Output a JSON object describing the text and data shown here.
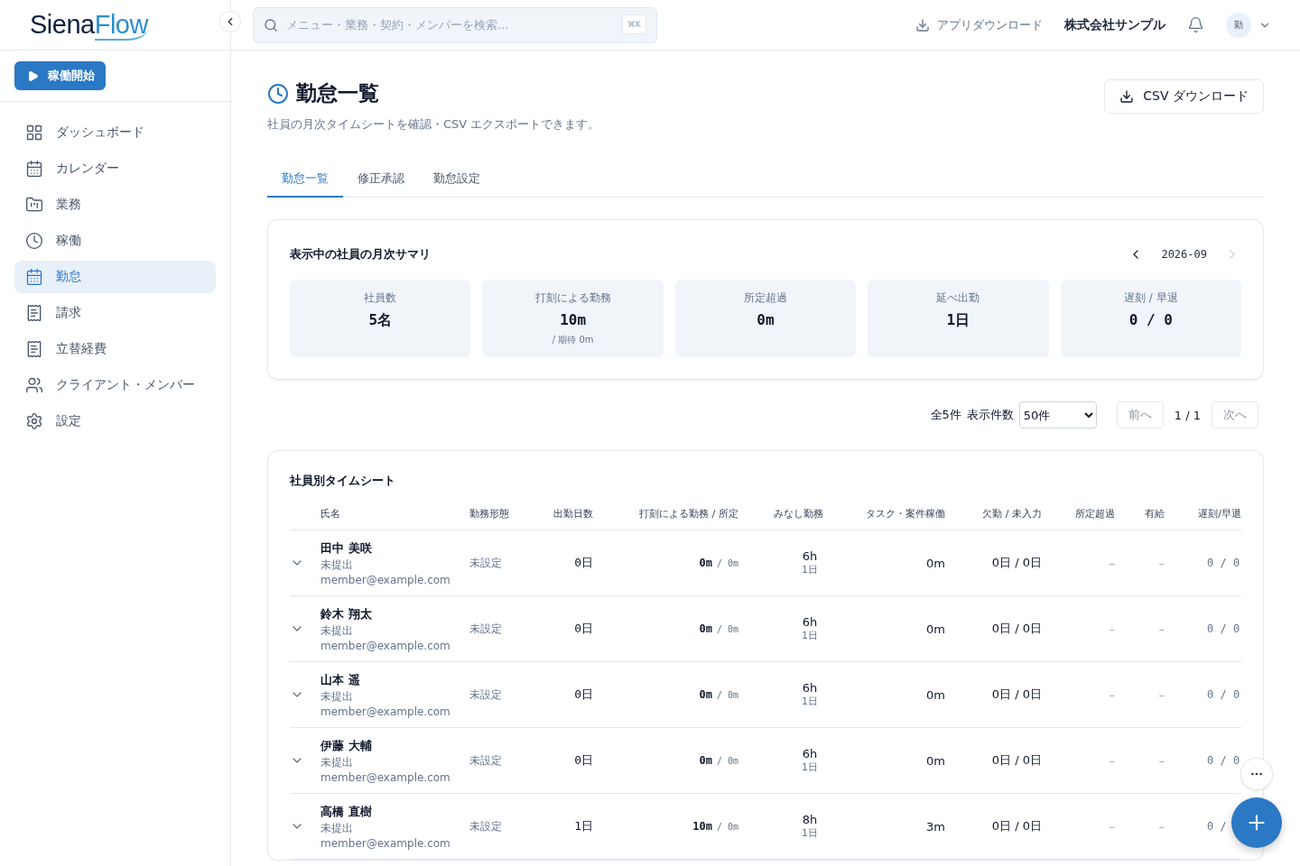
{
  "logo": {
    "part_1": "Siena",
    "part_2": "Flow"
  },
  "start_button": "稼働開始",
  "sidebar": {
    "items": [
      {
        "label": "ダッシュボード",
        "selected": false
      },
      {
        "label": "カレンダー",
        "selected": false
      },
      {
        "label": "業務",
        "selected": false
      },
      {
        "label": "稼働",
        "selected": false
      },
      {
        "label": "勤怠",
        "selected": true
      },
      {
        "label": "請求",
        "selected": false
      },
      {
        "label": "立替経費",
        "selected": false
      },
      {
        "label": "クライアント・メンバー",
        "selected": false
      },
      {
        "label": "設定",
        "selected": false
      }
    ]
  },
  "search": {
    "placeholder": "メニュー・業務・契約・メンバーを検索...",
    "shortcut": "⌘K"
  },
  "header": {
    "app_download": "アプリダウンロード",
    "company": "株式会社サンプル",
    "avatar": "勤"
  },
  "page": {
    "title": "勤怠一覧",
    "subtitle": "社員の月次タイムシートを確認・CSV エクスポートできます。",
    "csv_button": "CSV ダウンロード"
  },
  "tabs": [
    {
      "label": "勤怠一覧",
      "selected": true
    },
    {
      "label": "修正承認",
      "selected": false
    },
    {
      "label": "勤怠設定",
      "selected": false
    }
  ],
  "summary": {
    "title": "表示中の社員の月次サマリ",
    "month": "2026-09",
    "prev_disabled": false,
    "next_disabled": true,
    "cards": [
      {
        "label": "社員数",
        "value": "5名"
      },
      {
        "label": "打刻による勤務",
        "value": "10m",
        "sub": "/ 期待 0m"
      },
      {
        "label": "所定超過",
        "value": "0m"
      },
      {
        "label": "延べ出勤",
        "value": "1日"
      },
      {
        "label": "遅刻 / 早退",
        "value": "0 / 0"
      }
    ]
  },
  "pagination": {
    "total": "全5件",
    "per_page_label": "表示件数",
    "per_page": "50件",
    "prev": "前へ",
    "prev_disabled": true,
    "page": "1 / 1",
    "next": "次へ",
    "next_disabled": true
  },
  "table": {
    "title": "社員別タイムシート",
    "columns": [
      "氏名",
      "勤務形態",
      "出勤日数",
      "打刻による勤務 / 所定",
      "みなし勤務",
      "タスク・案件稼働",
      "欠勤 / 未入力",
      "所定超過",
      "有給",
      "遅刻/早退"
    ],
    "rows": [
      {
        "name": "田中 美咲",
        "status": "未提出",
        "email": "member@example.com",
        "work_type": "未設定",
        "days": "0日",
        "punch": "0m",
        "scheduled": "/ 0m",
        "deemed": "6h",
        "deemed_days": "1日",
        "task": "0m",
        "absence": "0日 / 0日",
        "overtime": "–",
        "paid_leave": "–",
        "late": "0 / 0"
      },
      {
        "name": "鈴木 翔太",
        "status": "未提出",
        "email": "member@example.com",
        "work_type": "未設定",
        "days": "0日",
        "punch": "0m",
        "scheduled": "/ 0m",
        "deemed": "6h",
        "deemed_days": "1日",
        "task": "0m",
        "absence": "0日 / 0日",
        "overtime": "–",
        "paid_leave": "–",
        "late": "0 / 0"
      },
      {
        "name": "山本 遥",
        "status": "未提出",
        "email": "member@example.com",
        "work_type": "未設定",
        "days": "0日",
        "punch": "0m",
        "scheduled": "/ 0m",
        "deemed": "6h",
        "deemed_days": "1日",
        "task": "0m",
        "absence": "0日 / 0日",
        "overtime": "–",
        "paid_leave": "–",
        "late": "0 / 0"
      },
      {
        "name": "伊藤 大輔",
        "status": "未提出",
        "email": "member@example.com",
        "work_type": "未設定",
        "days": "0日",
        "punch": "0m",
        "scheduled": "/ 0m",
        "deemed": "6h",
        "deemed_days": "1日",
        "task": "0m",
        "absence": "0日 / 0日",
        "overtime": "–",
        "paid_leave": "–",
        "late": "0 / 0"
      },
      {
        "name": "高橋 直樹",
        "status": "未提出",
        "email": "member@example.com",
        "work_type": "未設定",
        "days": "1日",
        "punch": "10m",
        "scheduled": "/ 0m",
        "deemed": "8h",
        "deemed_days": "1日",
        "task": "3m",
        "absence": "0日 / 0日",
        "overtime": "–",
        "paid_leave": "–",
        "late": "0 /"
      }
    ]
  }
}
